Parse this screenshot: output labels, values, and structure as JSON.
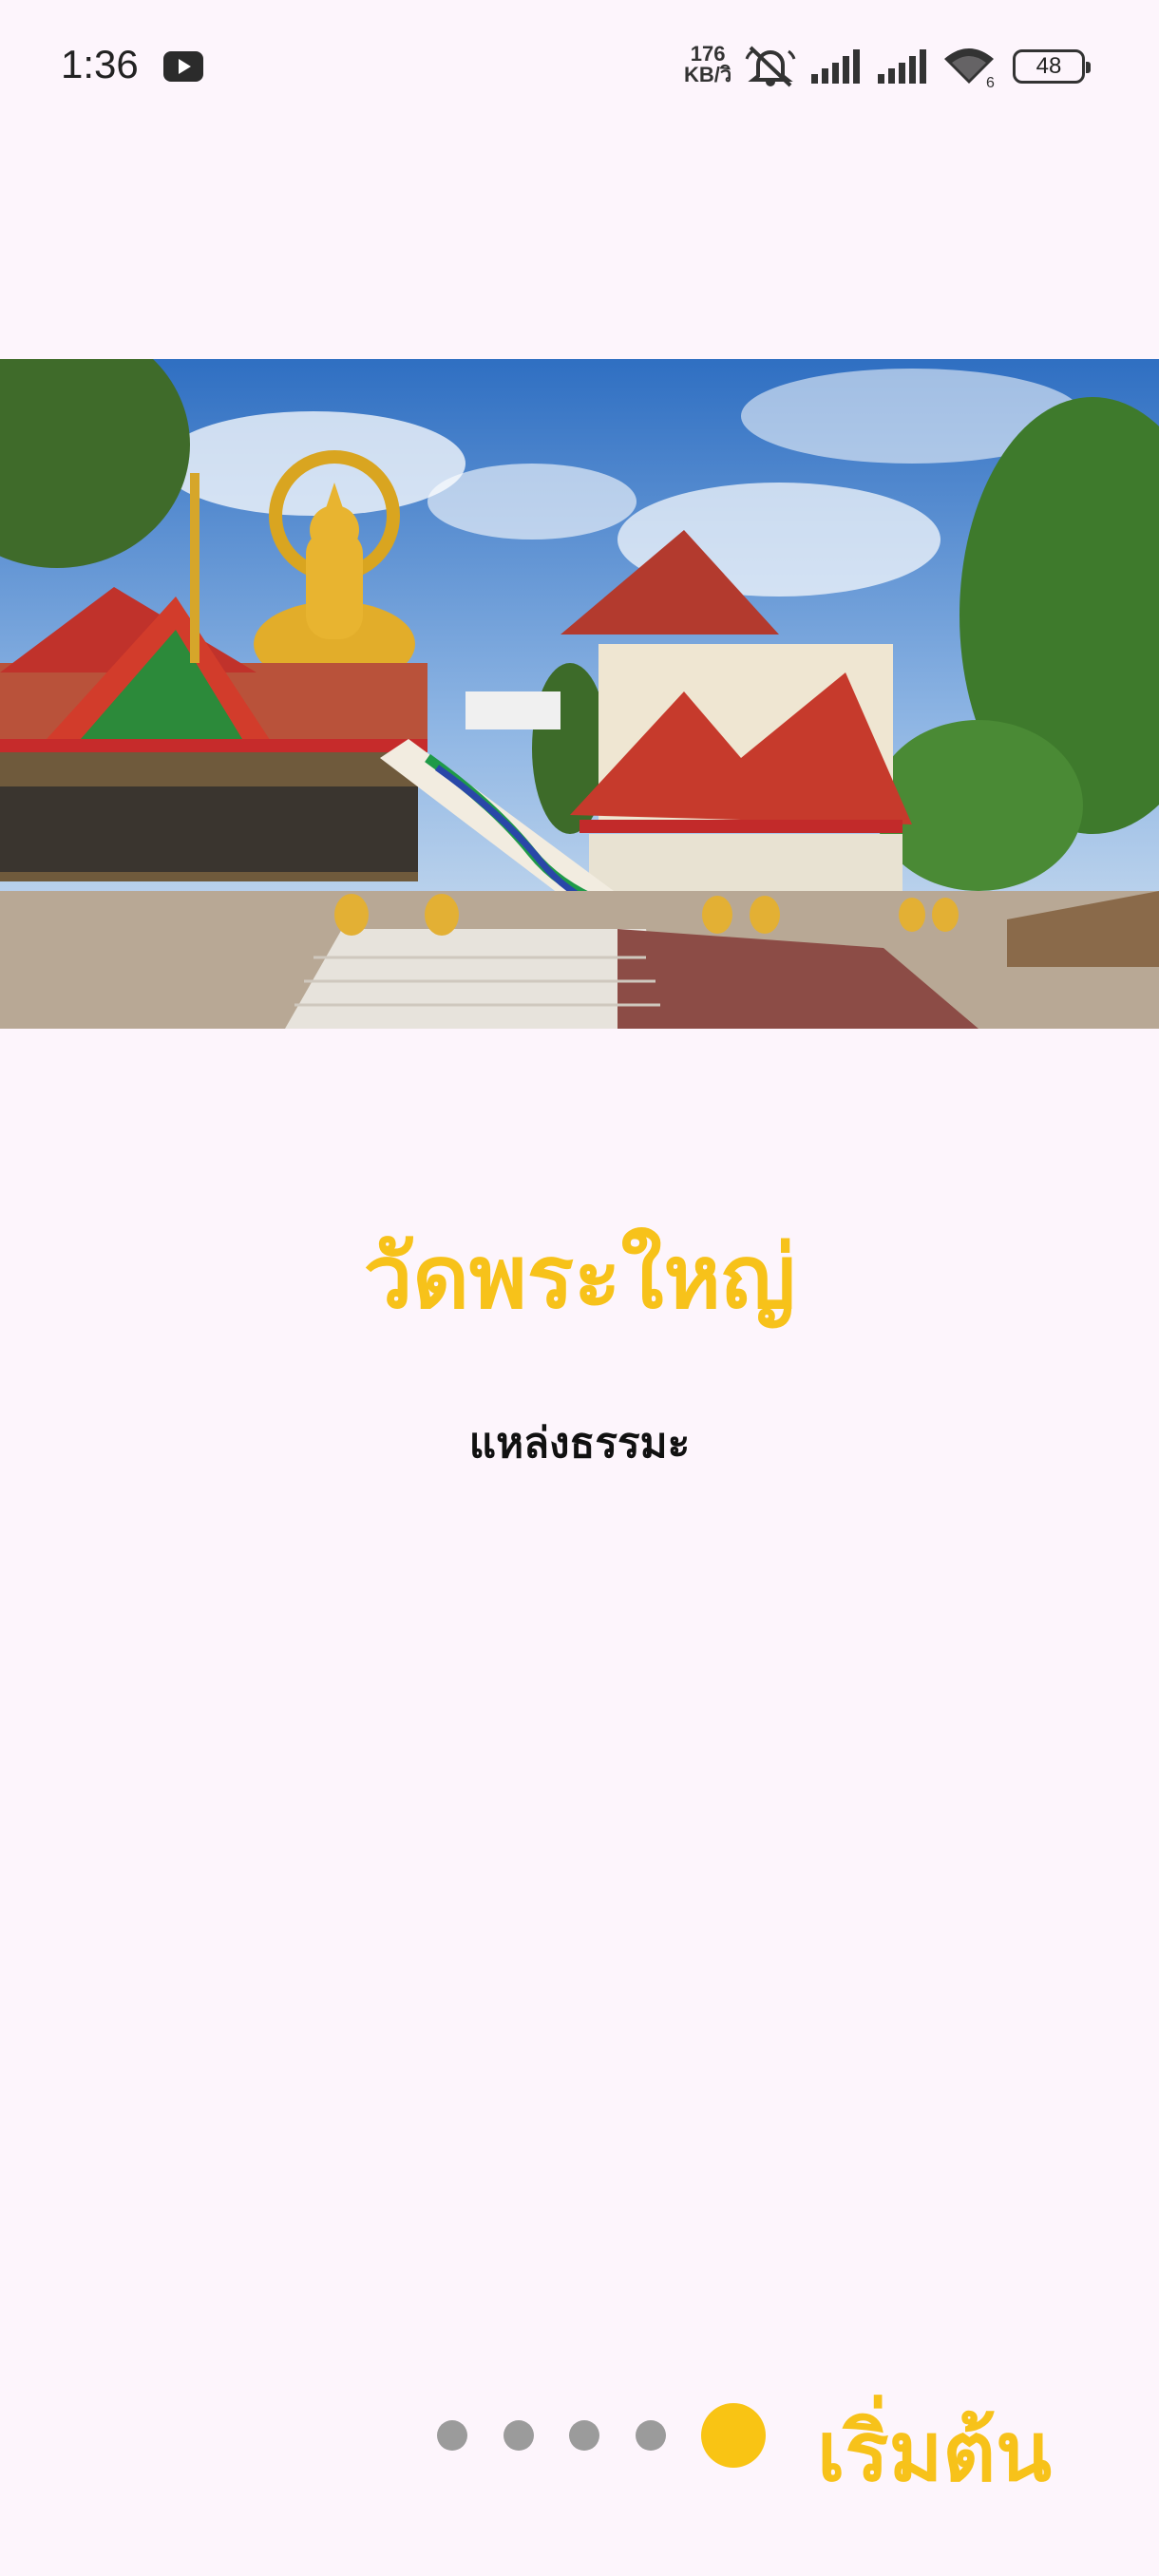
{
  "status_bar": {
    "time": "1:36",
    "net_speed_value": "176",
    "net_speed_unit": "KB/วิ",
    "battery": "48",
    "icons": [
      "youtube-icon",
      "mute-icon",
      "signal-icon",
      "signal-icon",
      "wifi-icon",
      "battery-icon"
    ]
  },
  "onboarding": {
    "title": "วัดพระใหญ่",
    "subtitle": "แหล่งธรรมะ",
    "start_label": "เริ่มต้น",
    "page_count": 5,
    "active_page": 5
  },
  "colors": {
    "accent": "#f7c21a",
    "background": "#fdf5fc",
    "dot_inactive": "#9b9b9b"
  }
}
